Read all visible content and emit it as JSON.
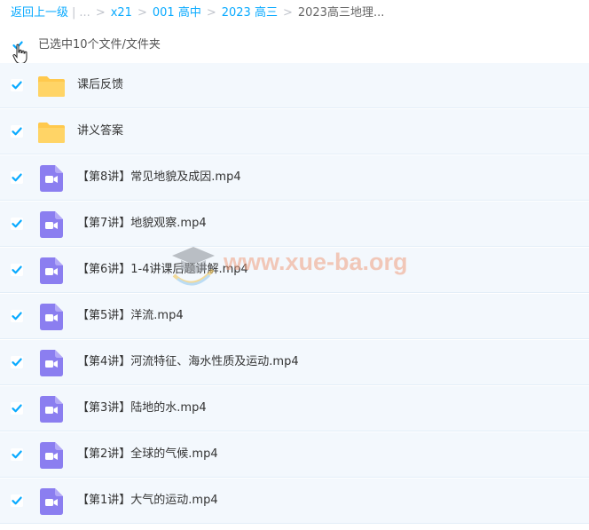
{
  "breadcrumb": {
    "back_label": "返回上一级",
    "ellipsis": "...",
    "items": [
      "x21",
      "001 高中",
      "2023 高三"
    ],
    "current": "2023高三地理..."
  },
  "selection": {
    "text": "已选中10个文件/文件夹",
    "all_checked": true
  },
  "files": [
    {
      "name": "课后反馈",
      "type": "folder",
      "checked": true
    },
    {
      "name": "讲义答案",
      "type": "folder",
      "checked": true
    },
    {
      "name": "【第8讲】常见地貌及成因.mp4",
      "type": "video",
      "checked": true
    },
    {
      "name": "【第7讲】地貌观察.mp4",
      "type": "video",
      "checked": true
    },
    {
      "name": "【第6讲】1-4讲课后题讲解.mp4",
      "type": "video",
      "checked": true
    },
    {
      "name": "【第5讲】洋流.mp4",
      "type": "video",
      "checked": true
    },
    {
      "name": "【第4讲】河流特征、海水性质及运动.mp4",
      "type": "video",
      "checked": true
    },
    {
      "name": "【第3讲】陆地的水.mp4",
      "type": "video",
      "checked": true
    },
    {
      "name": "【第2讲】全球的气候.mp4",
      "type": "video",
      "checked": true
    },
    {
      "name": "【第1讲】大气的运动.mp4",
      "type": "video",
      "checked": true
    }
  ],
  "watermark": {
    "text": "www.xue-ba.org"
  },
  "colors": {
    "accent": "#09aaff",
    "row_bg": "#f3f8fd",
    "folder": "#ffc94d",
    "video": "#8b7ef0"
  }
}
